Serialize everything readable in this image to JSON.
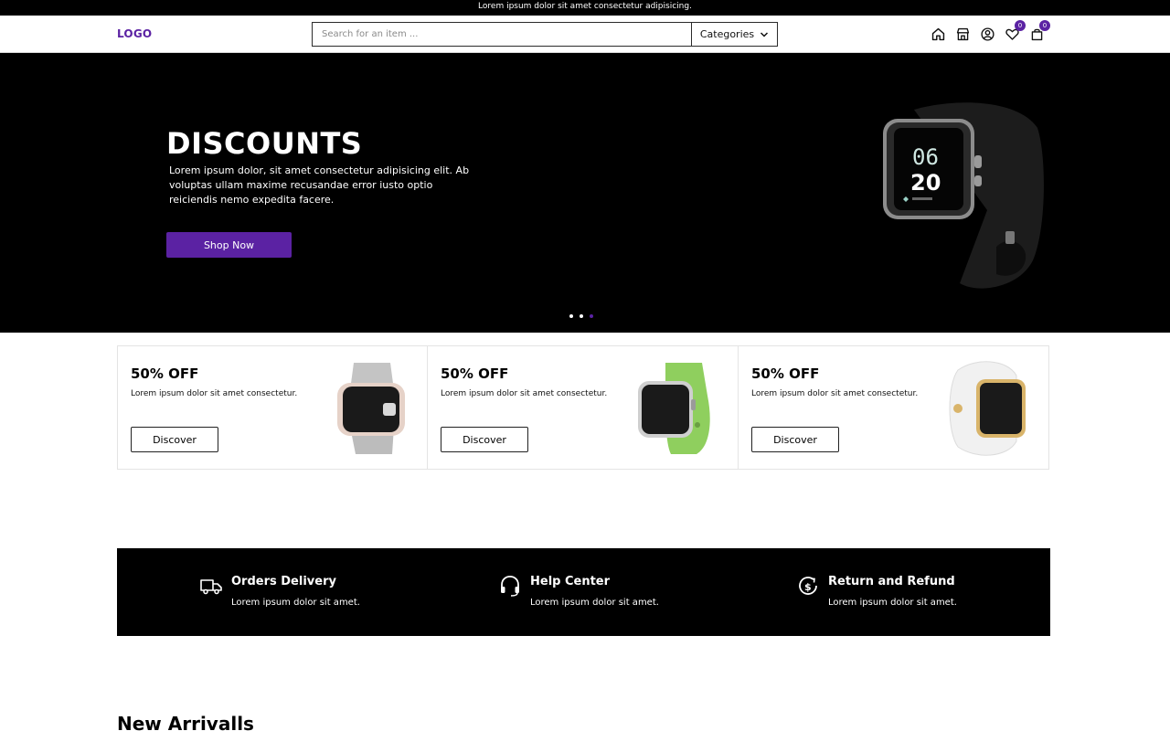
{
  "announcement": "Lorem ipsum dolor sit amet consectetur adipisicing.",
  "header": {
    "logo": "LOGO",
    "search_placeholder": "Search for an item ...",
    "categories_label": "Categories",
    "wishlist_count": "0",
    "cart_count": "0"
  },
  "hero": {
    "title": "DISCOUNTS",
    "text": "Lorem ipsum dolor, sit amet consectetur adipisicing elit. Ab voluptas ullam maxime recusandae error iusto optio reiciendis nemo expedita facere.",
    "button": "Shop Now",
    "watch_time_hour": "06",
    "watch_time_min": "20",
    "slide_count": 3,
    "active_slide": 3
  },
  "promo_cards": [
    {
      "title": "50% OFF",
      "text": "Lorem ipsum dolor sit amet consectetur.",
      "button": "Discover",
      "watch_color": "#bdbdbd"
    },
    {
      "title": "50% OFF",
      "text": "Lorem ipsum dolor sit amet consectetur.",
      "button": "Discover",
      "watch_color": "#8fcf5e"
    },
    {
      "title": "50% OFF",
      "text": "Lorem ipsum dolor sit amet consectetur.",
      "button": "Discover",
      "watch_color": "#efefef"
    }
  ],
  "services": [
    {
      "icon": "delivery-truck-icon",
      "title": "Orders Delivery",
      "text": "Lorem ipsum dolor sit amet."
    },
    {
      "icon": "headset-icon",
      "title": "Help Center",
      "text": "Lorem ipsum dolor sit amet."
    },
    {
      "icon": "refund-icon",
      "title": "Return and Refund",
      "text": "Lorem ipsum dolor sit amet."
    }
  ],
  "new_arrivals_title": "New Arrivalls",
  "colors": {
    "accent": "#5b22a3",
    "dark": "#000000"
  }
}
